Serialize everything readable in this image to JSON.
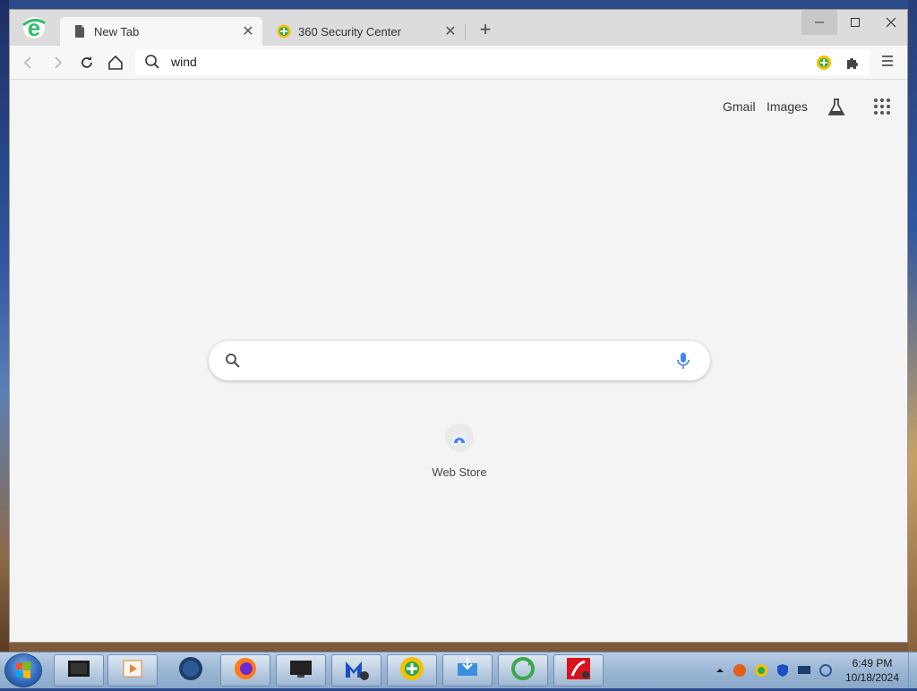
{
  "browser": {
    "tabs": [
      {
        "title": "New Tab",
        "active": true
      },
      {
        "title": "360 Security Center",
        "active": false
      }
    ],
    "address_bar": {
      "value": "wind"
    }
  },
  "newtab": {
    "links": {
      "gmail": "Gmail",
      "images": "Images"
    },
    "search_placeholder": "",
    "shortcuts": [
      {
        "label": "Web Store"
      }
    ]
  },
  "taskbar": {
    "apps": [
      "terminal-icon",
      "media-player-icon",
      "globe-icon",
      "firefox-icon",
      "display-icon",
      "malwarebytes-icon",
      "360-security-icon",
      "download-monitor-icon",
      "recycle-icon",
      "avira-icon"
    ],
    "clock": {
      "time": "6:49 PM",
      "date": "10/18/2024"
    }
  },
  "colors": {
    "accent_green": "#2fbf6a",
    "brand_360": "#f2c200"
  }
}
